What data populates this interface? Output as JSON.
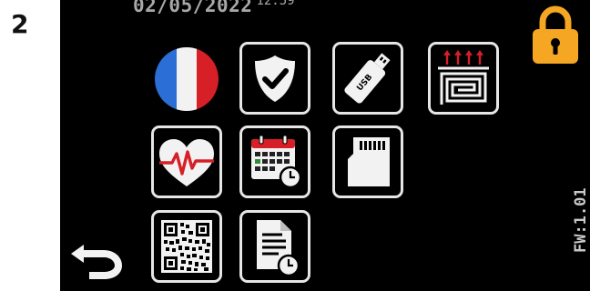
{
  "step_number": "2",
  "header": {
    "date": "02/05/2022",
    "time": "12:59"
  },
  "firmware": "FW:1.01",
  "icons": {
    "lock": "padlock-icon",
    "language": "french-flag-icon",
    "security": "shield-check-icon",
    "usb": "usb-stick-icon",
    "usb_text": "USB",
    "heating": "floor-heating-icon",
    "health": "heart-pulse-icon",
    "calendar": "calendar-clock-icon",
    "sd_card": "sd-card-icon",
    "qr": "qr-code-icon",
    "report": "document-clock-icon",
    "back": "back-arrow-icon"
  },
  "colors": {
    "lock": "#f5a623",
    "accent_red": "#d61f26",
    "flag_blue": "#2b6fd6",
    "calendar_green": "#2e8b3a"
  }
}
